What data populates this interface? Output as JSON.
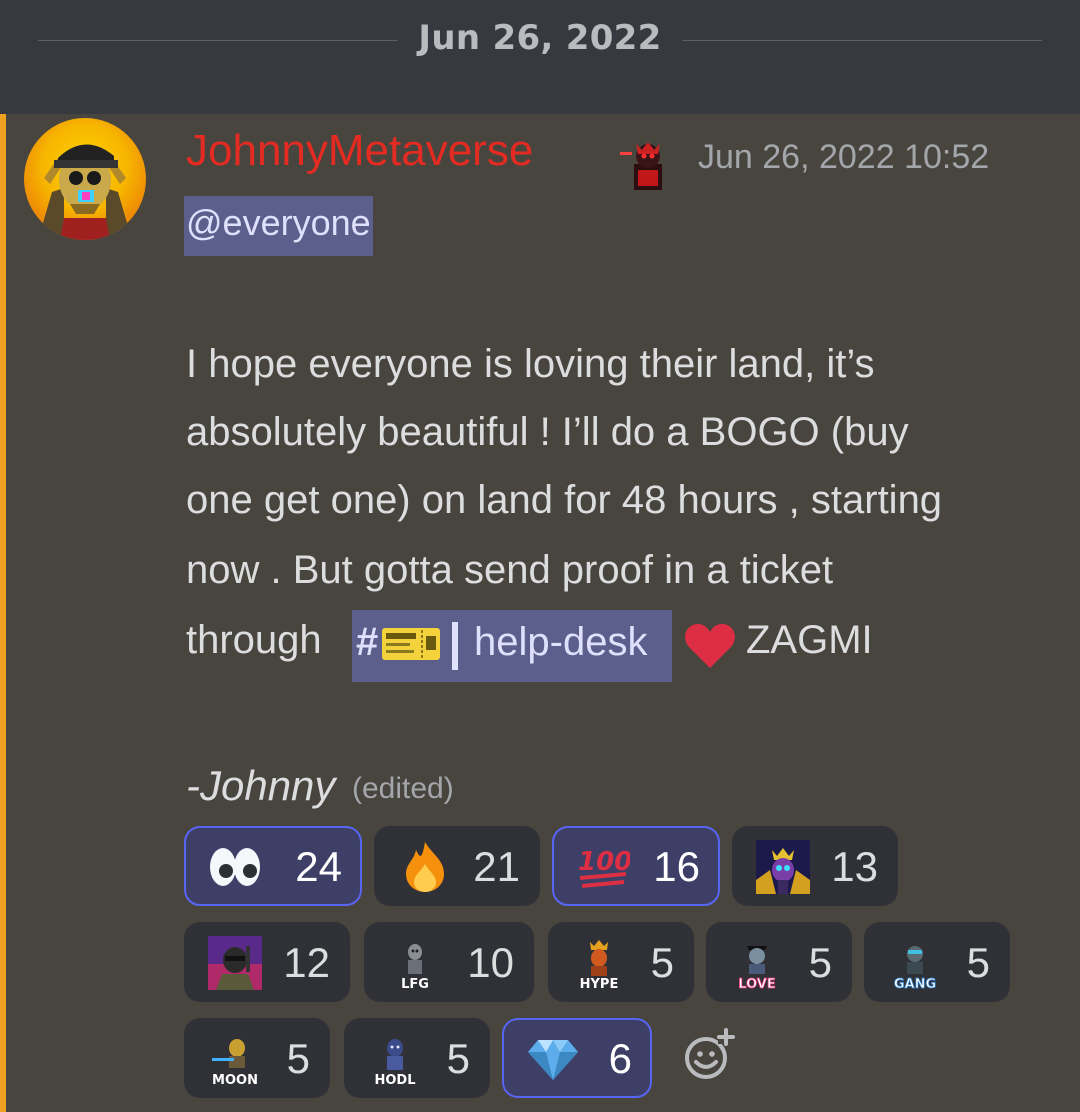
{
  "divider": {
    "date": "Jun 26, 2022"
  },
  "message": {
    "author": "JohnnyMetaverse",
    "timestamp": "Jun 26, 2022 10:52",
    "mention": "@everyone",
    "lines": [
      "I hope everyone is loving their land, it’s",
      "absolutely beautiful ! I’ll do a BOGO (buy",
      "one get one) on land for 48 hours , starting",
      "now . But gotta send proof in a ticket",
      "through"
    ],
    "channel": {
      "hash": "#",
      "name": "help-desk"
    },
    "after_channel": "ZAGMI",
    "signature": "-Johnny",
    "edited": "(edited)",
    "colors": {
      "author": "#e32b22",
      "mention_stripe": "#f0a020",
      "mention_bg": "#5c5f8c"
    }
  },
  "reactions": [
    {
      "emoji": "eyes-icon",
      "count": "24",
      "me": true
    },
    {
      "emoji": "fire-icon",
      "count": "21",
      "me": false
    },
    {
      "emoji": "hundred-points-icon",
      "count": "16",
      "me": true
    },
    {
      "emoji": "skull-king-emoji",
      "count": "13",
      "me": false
    },
    {
      "emoji": "soldier-emoji",
      "count": "12",
      "me": false
    },
    {
      "emoji": "lfg-emoji",
      "count": "10",
      "me": false,
      "label": "LFG"
    },
    {
      "emoji": "hype-emoji",
      "count": "5",
      "me": false,
      "label": "HYPE"
    },
    {
      "emoji": "love-emoji",
      "count": "5",
      "me": false,
      "label": "LOVE"
    },
    {
      "emoji": "gang-emoji",
      "count": "5",
      "me": false,
      "label": "GANG"
    },
    {
      "emoji": "moon-emoji",
      "count": "5",
      "me": false,
      "label": "MOON"
    },
    {
      "emoji": "hodl-emoji",
      "count": "5",
      "me": false,
      "label": "HODL"
    },
    {
      "emoji": "gem-icon",
      "count": "6",
      "me": true
    }
  ]
}
